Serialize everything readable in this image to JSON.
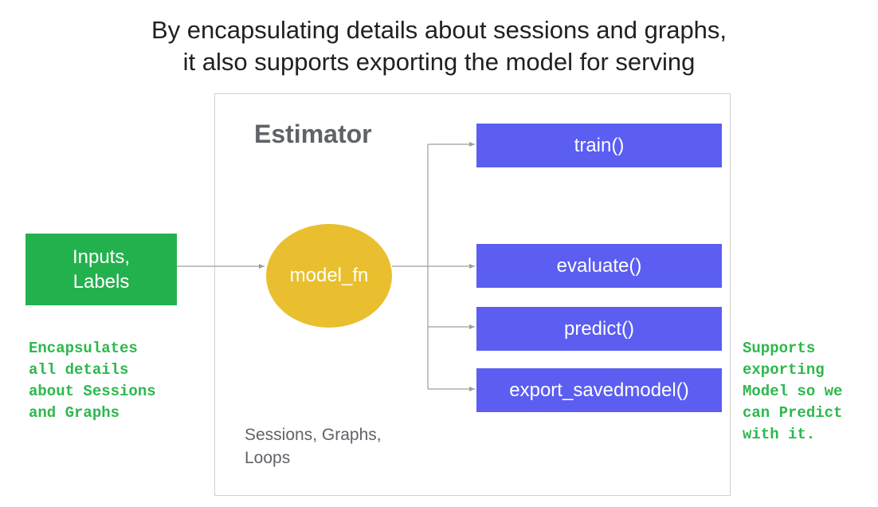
{
  "title": {
    "line1": "By encapsulating details about sessions and graphs,",
    "line2": "it also supports exporting the model for serving"
  },
  "estimator": {
    "label": "Estimator",
    "internals_line1": "Sessions, Graphs,",
    "internals_line2": "Loops"
  },
  "inputs": {
    "line1": "Inputs,",
    "line2": "Labels"
  },
  "model_fn": "model_fn",
  "methods": [
    "train()",
    "evaluate()",
    "predict()",
    "export_savedmodel()"
  ],
  "notes": {
    "left": [
      "Encapsulates",
      "all details",
      "about Sessions",
      "and Graphs"
    ],
    "right": [
      "Supports",
      "exporting",
      "Model so we",
      "can Predict",
      "with it."
    ]
  },
  "colors": {
    "inputs": "#23b14d",
    "model_fn": "#e9bf2f",
    "methods": "#5b5ef0",
    "notes": "#2db84d"
  }
}
